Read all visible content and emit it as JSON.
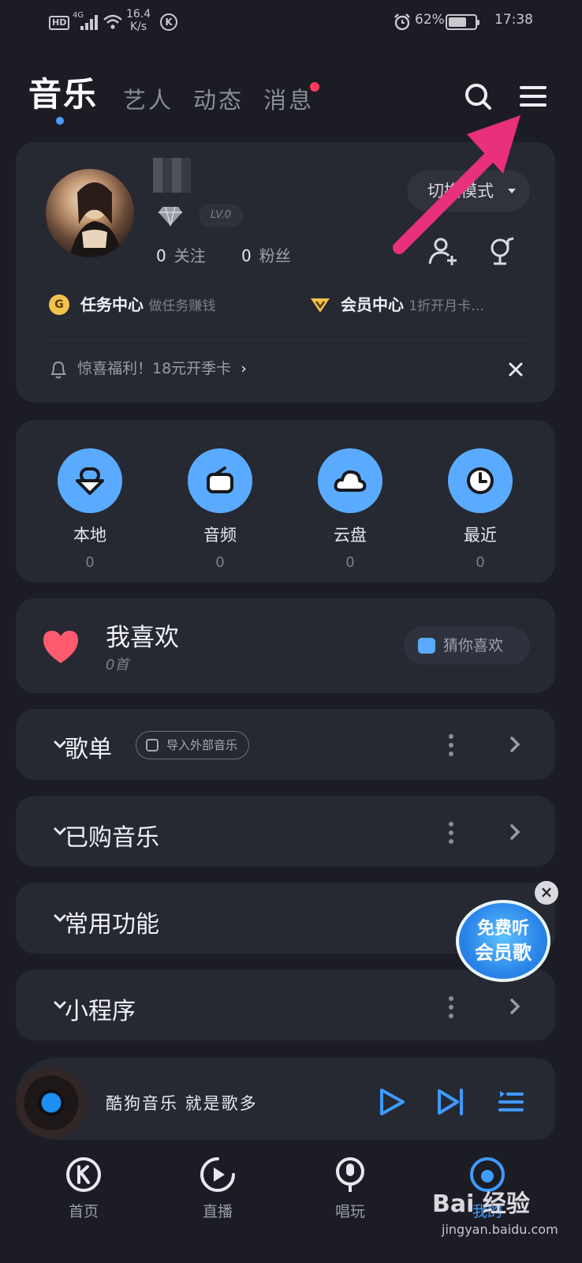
{
  "status_bar": {
    "hd": "HD",
    "network": "4G",
    "speed_top": "16.4",
    "speed_bottom": "K/s",
    "app_badge": "K",
    "battery": "62%",
    "time": "17:38"
  },
  "top_tabs": {
    "active": "音乐",
    "items": [
      "艺人",
      "动态",
      "消息"
    ],
    "message_has_dot": true
  },
  "profile": {
    "level": "LV.0",
    "following_count": "0",
    "following_label": "关注",
    "fans_count": "0",
    "fans_label": "粉丝",
    "switch_mode_label": "切换模式",
    "task_center": "任务中心",
    "task_center_sub": "做任务赚钱",
    "vip_center": "会员中心",
    "vip_center_sub": "1折开月卡…",
    "promo_text": "惊喜福利！18元开季卡"
  },
  "quick_access": [
    {
      "label": "本地",
      "count": "0",
      "icon": "local-icon"
    },
    {
      "label": "音频",
      "count": "0",
      "icon": "radio-icon"
    },
    {
      "label": "云盘",
      "count": "0",
      "icon": "cloud-icon"
    },
    {
      "label": "最近",
      "count": "0",
      "icon": "clock-icon"
    }
  ],
  "favorites": {
    "title": "我喜欢",
    "count": "0首",
    "guess_label": "猜你喜欢"
  },
  "sections": {
    "playlists": "歌单",
    "import_label": "导入外部音乐",
    "purchased": "已购音乐",
    "common": "常用功能",
    "mini_programs": "小程序"
  },
  "floating_badge": {
    "line1": "免费听",
    "line2": "会员歌"
  },
  "player": {
    "text": "酷狗音乐 就是歌多"
  },
  "bottom_nav": [
    {
      "label": "首页",
      "icon": "home-k-icon"
    },
    {
      "label": "直播",
      "icon": "live-play-icon"
    },
    {
      "label": "唱玩",
      "icon": "mic-icon"
    },
    {
      "label": "我的",
      "icon": "me-icon"
    }
  ],
  "watermark": {
    "brand": "Bai 经验",
    "url": "jingyan.baidu.com"
  },
  "colors": {
    "background": "#1c1d24",
    "card": "#262832",
    "accent": "#5aabff",
    "arrow": "#e8317a",
    "heart": "#ff5b6e"
  }
}
